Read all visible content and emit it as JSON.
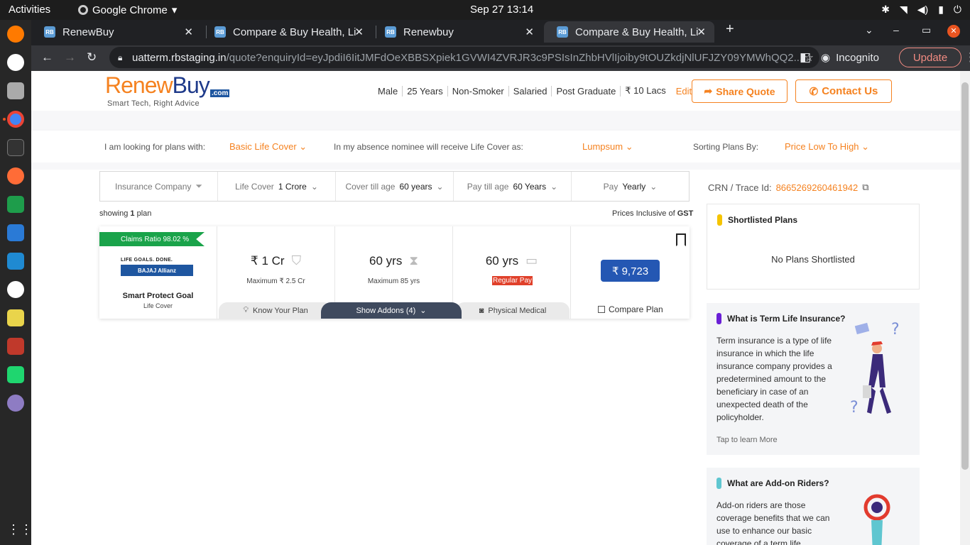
{
  "os": {
    "activities": "Activities",
    "app": "Google Chrome",
    "clock": "Sep 27  13:14"
  },
  "tabs": [
    {
      "label": "RenewBuy",
      "active": false
    },
    {
      "label": "Compare & Buy Health, Li",
      "active": false
    },
    {
      "label": "Renewbuy",
      "active": false
    },
    {
      "label": "Compare & Buy Health, Li",
      "active": true
    }
  ],
  "address": {
    "host": "uatterm.rbstaging.in",
    "path": "/quote?enquiryId=eyJpdiI6IitJMFdOeXBBSXpiek1GVWI4ZVRJR3c9PSIsInZhbHVlIjoiby9tOUZkdjNlUFJZY09YMWhQQ2..."
  },
  "browser": {
    "incognito": "Incognito",
    "update": "Update"
  },
  "header": {
    "logo_renew": "Renew",
    "logo_buy": "Buy",
    "logo_com": ".com",
    "tagline": "Smart Tech, Right Advice",
    "profile": [
      "Male",
      "25 Years",
      "Non-Smoker",
      "Salaried",
      "Post Graduate",
      "₹ 10 Lacs"
    ],
    "edit": "Edit",
    "share": "Share Quote",
    "contact": "Contact Us"
  },
  "filters": {
    "looking": "I am looking for plans with:",
    "looking_val": "Basic Life Cover",
    "absence": "In my absence nominee will receive Life Cover as:",
    "absence_val": "Lumpsum",
    "sorting": "Sorting Plans By:",
    "sorting_val": "Price Low To High"
  },
  "fbox": {
    "insurer": "Insurance Company",
    "life_cover": "Life Cover",
    "life_cover_val": "1 Crore",
    "cover_till": "Cover till age",
    "cover_till_val": "60 years",
    "pay_till": "Pay till age",
    "pay_till_val": "60 Years",
    "pay": "Pay",
    "pay_val": "Yearly"
  },
  "results": {
    "showing_pre": "showing",
    "count": "1",
    "showing_post": "plan",
    "prices": "Prices Inclusive of",
    "gst": "GST"
  },
  "plan": {
    "claims": "Claims Ratio 98.02 %",
    "insurer_tag": "LIFE GOALS. DONE.",
    "insurer_name": "BAJAJ Allianz",
    "name": "Smart Protect Goal",
    "type": "Life Cover",
    "cover": "₹ 1 Cr",
    "cover_max": "Maximum ₹ 2.5 Cr",
    "till": "60 yrs",
    "till_max": "Maximum 85 yrs",
    "pay": "60 yrs",
    "pay_type": "Regular Pay",
    "price": "₹ 9,723",
    "compare": "Compare Plan",
    "know": "Know Your Plan",
    "addons": "Show Addons (4)",
    "medical": "Physical Medical"
  },
  "crn": {
    "label": "CRN / Trace Id:",
    "id": "8665269260461942"
  },
  "shortlist": {
    "title": "Shortlisted Plans",
    "empty": "No Plans Shortlisted"
  },
  "term": {
    "title": "What is Term Life Insurance?",
    "body": "Term insurance is a type of life insurance in which the life insurance company provides a predetermined amount to the beneficiary in case of an unexpected death of the policyholder.",
    "cta": "Tap to learn More"
  },
  "riders": {
    "title": "What are Add-on Riders?",
    "body": "Add-on riders are those coverage benefits that we can use to enhance our basic coverage of a term life"
  },
  "colors": {
    "brand": "#f58220",
    "navy": "#1e3a8a",
    "green": "#1aa34a",
    "blue": "#2457b3"
  }
}
